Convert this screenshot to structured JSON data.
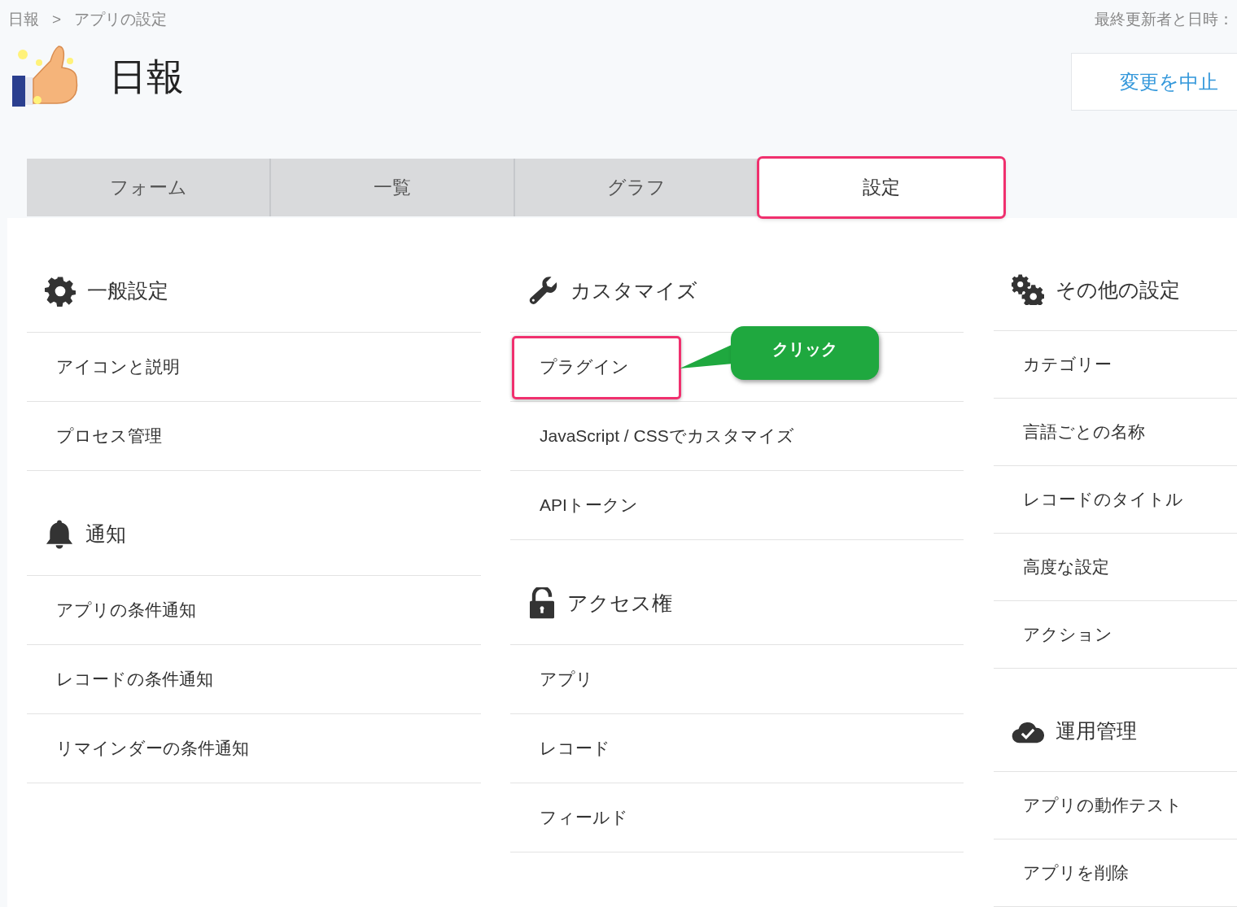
{
  "breadcrumb": {
    "items": [
      "日報",
      "アプリの設定"
    ],
    "separator": ">"
  },
  "last_updated_label": "最終更新者と日時：",
  "app": {
    "title": "日報"
  },
  "cancel_button": "変更を中止",
  "tabs": [
    {
      "label": "フォーム",
      "selected": false,
      "highlighted": false
    },
    {
      "label": "一覧",
      "selected": false,
      "highlighted": false
    },
    {
      "label": "グラフ",
      "selected": false,
      "highlighted": false
    },
    {
      "label": "設定",
      "selected": true,
      "highlighted": true
    }
  ],
  "columns": [
    {
      "sections": [
        {
          "title": "一般設定",
          "kind": "gear",
          "items": [
            {
              "label": "アイコンと説明",
              "highlighted": false
            },
            {
              "label": "プロセス管理",
              "highlighted": false
            }
          ]
        },
        {
          "title": "通知",
          "kind": "bell",
          "items": [
            {
              "label": "アプリの条件通知",
              "highlighted": false
            },
            {
              "label": "レコードの条件通知",
              "highlighted": false
            },
            {
              "label": "リマインダーの条件通知",
              "highlighted": false
            }
          ]
        }
      ]
    },
    {
      "sections": [
        {
          "title": "カスタマイズ",
          "kind": "wrench",
          "items": [
            {
              "label": "プラグイン",
              "highlighted": true,
              "callout": "クリック"
            },
            {
              "label": "JavaScript / CSSでカスタマイズ",
              "highlighted": false
            },
            {
              "label": "APIトークン",
              "highlighted": false
            }
          ]
        },
        {
          "title": "アクセス権",
          "kind": "lock",
          "items": [
            {
              "label": "アプリ",
              "highlighted": false
            },
            {
              "label": "レコード",
              "highlighted": false
            },
            {
              "label": "フィールド",
              "highlighted": false
            }
          ]
        }
      ]
    },
    {
      "sections": [
        {
          "title": "その他の設定",
          "kind": "gears",
          "items": [
            {
              "label": "カテゴリー",
              "highlighted": false
            },
            {
              "label": "言語ごとの名称",
              "highlighted": false
            },
            {
              "label": "レコードのタイトル",
              "highlighted": false
            },
            {
              "label": "高度な設定",
              "highlighted": false
            },
            {
              "label": "アクション",
              "highlighted": false
            }
          ]
        },
        {
          "title": "運用管理",
          "kind": "cloud",
          "items": [
            {
              "label": "アプリの動作テスト",
              "highlighted": false
            },
            {
              "label": "アプリを削除",
              "highlighted": false
            }
          ]
        }
      ]
    }
  ]
}
